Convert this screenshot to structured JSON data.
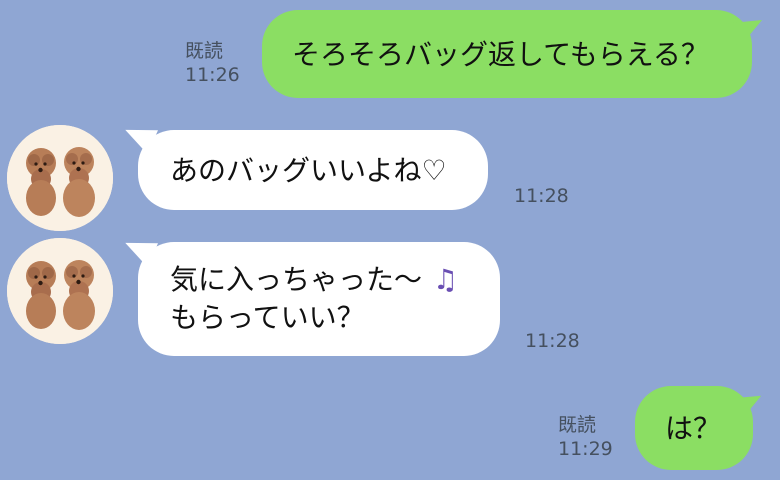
{
  "messages": [
    {
      "id": "m1",
      "sender": "me",
      "text": "そろそろバッグ返してもらえる？",
      "read_label": "既読",
      "time": "11:26"
    },
    {
      "id": "m2",
      "sender": "them",
      "text": "あのバッグいいよね♡",
      "time": "11:28"
    },
    {
      "id": "m3",
      "sender": "them",
      "text_line1": "気に入っちゃった〜",
      "text_line2": "もらっていい？",
      "icon": "music-note-icon",
      "time": "11:28"
    },
    {
      "id": "m4",
      "sender": "me",
      "text": "は？",
      "read_label": "既読",
      "time": "11:29"
    }
  ],
  "colors": {
    "background": "#8fa6d3",
    "outgoing_bubble": "#8bde63",
    "incoming_bubble": "#ffffff",
    "meta_text": "#45505f",
    "music_icon": "#6a4fb3"
  }
}
